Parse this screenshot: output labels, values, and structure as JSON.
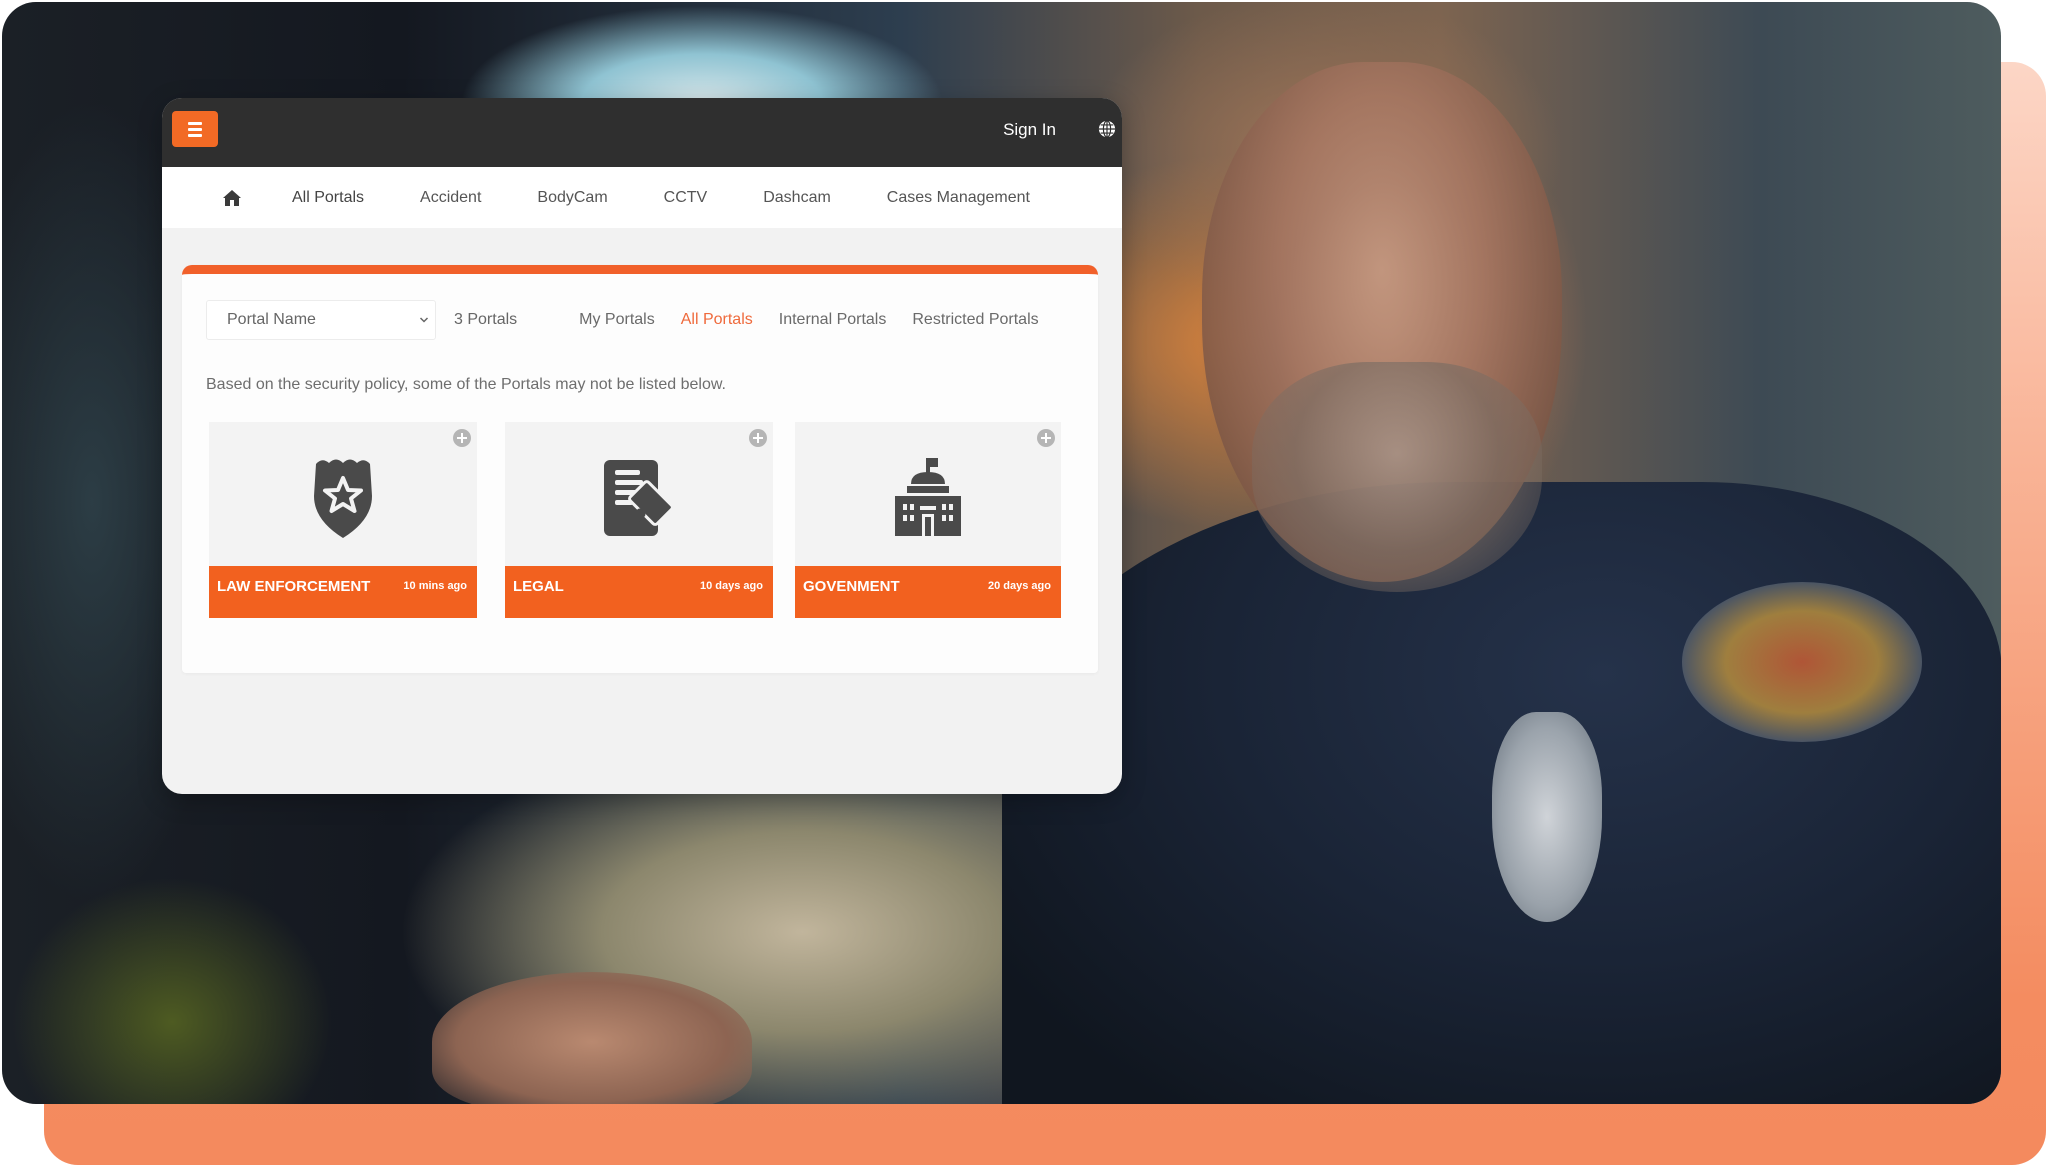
{
  "header": {
    "menu_icon": "hamburger-icon",
    "sign_in_label": "Sign In",
    "language_icon": "globe-icon"
  },
  "nav": {
    "home_icon": "home-icon",
    "items": [
      {
        "label": "All Portals"
      },
      {
        "label": "Accident"
      },
      {
        "label": "BodyCam"
      },
      {
        "label": "CCTV"
      },
      {
        "label": "Dashcam"
      },
      {
        "label": "Cases Management"
      }
    ]
  },
  "filters": {
    "select_value": "Portal Name",
    "count_label": "3 Portals",
    "tabs": [
      {
        "label": "My Portals",
        "active": false
      },
      {
        "label": "All Portals",
        "active": true
      },
      {
        "label": "Internal Portals",
        "active": false
      },
      {
        "label": "Restricted Portals",
        "active": false
      }
    ]
  },
  "notice": "Based on the security policy, some of the Portals may not be listed below.",
  "portals": [
    {
      "title": "LAW ENFORCEMENT",
      "time": "10 mins ago",
      "icon": "police-badge-icon"
    },
    {
      "title": "LEGAL",
      "time": "10 days ago",
      "icon": "legal-document-gavel-icon"
    },
    {
      "title": "GOVENMENT",
      "time": "20 days ago",
      "icon": "government-building-icon"
    }
  ],
  "colors": {
    "accent": "#f2611f",
    "active_tab": "#ef6a3c",
    "header_bg": "#2f2f2f",
    "icon": "#4a4a4a"
  }
}
